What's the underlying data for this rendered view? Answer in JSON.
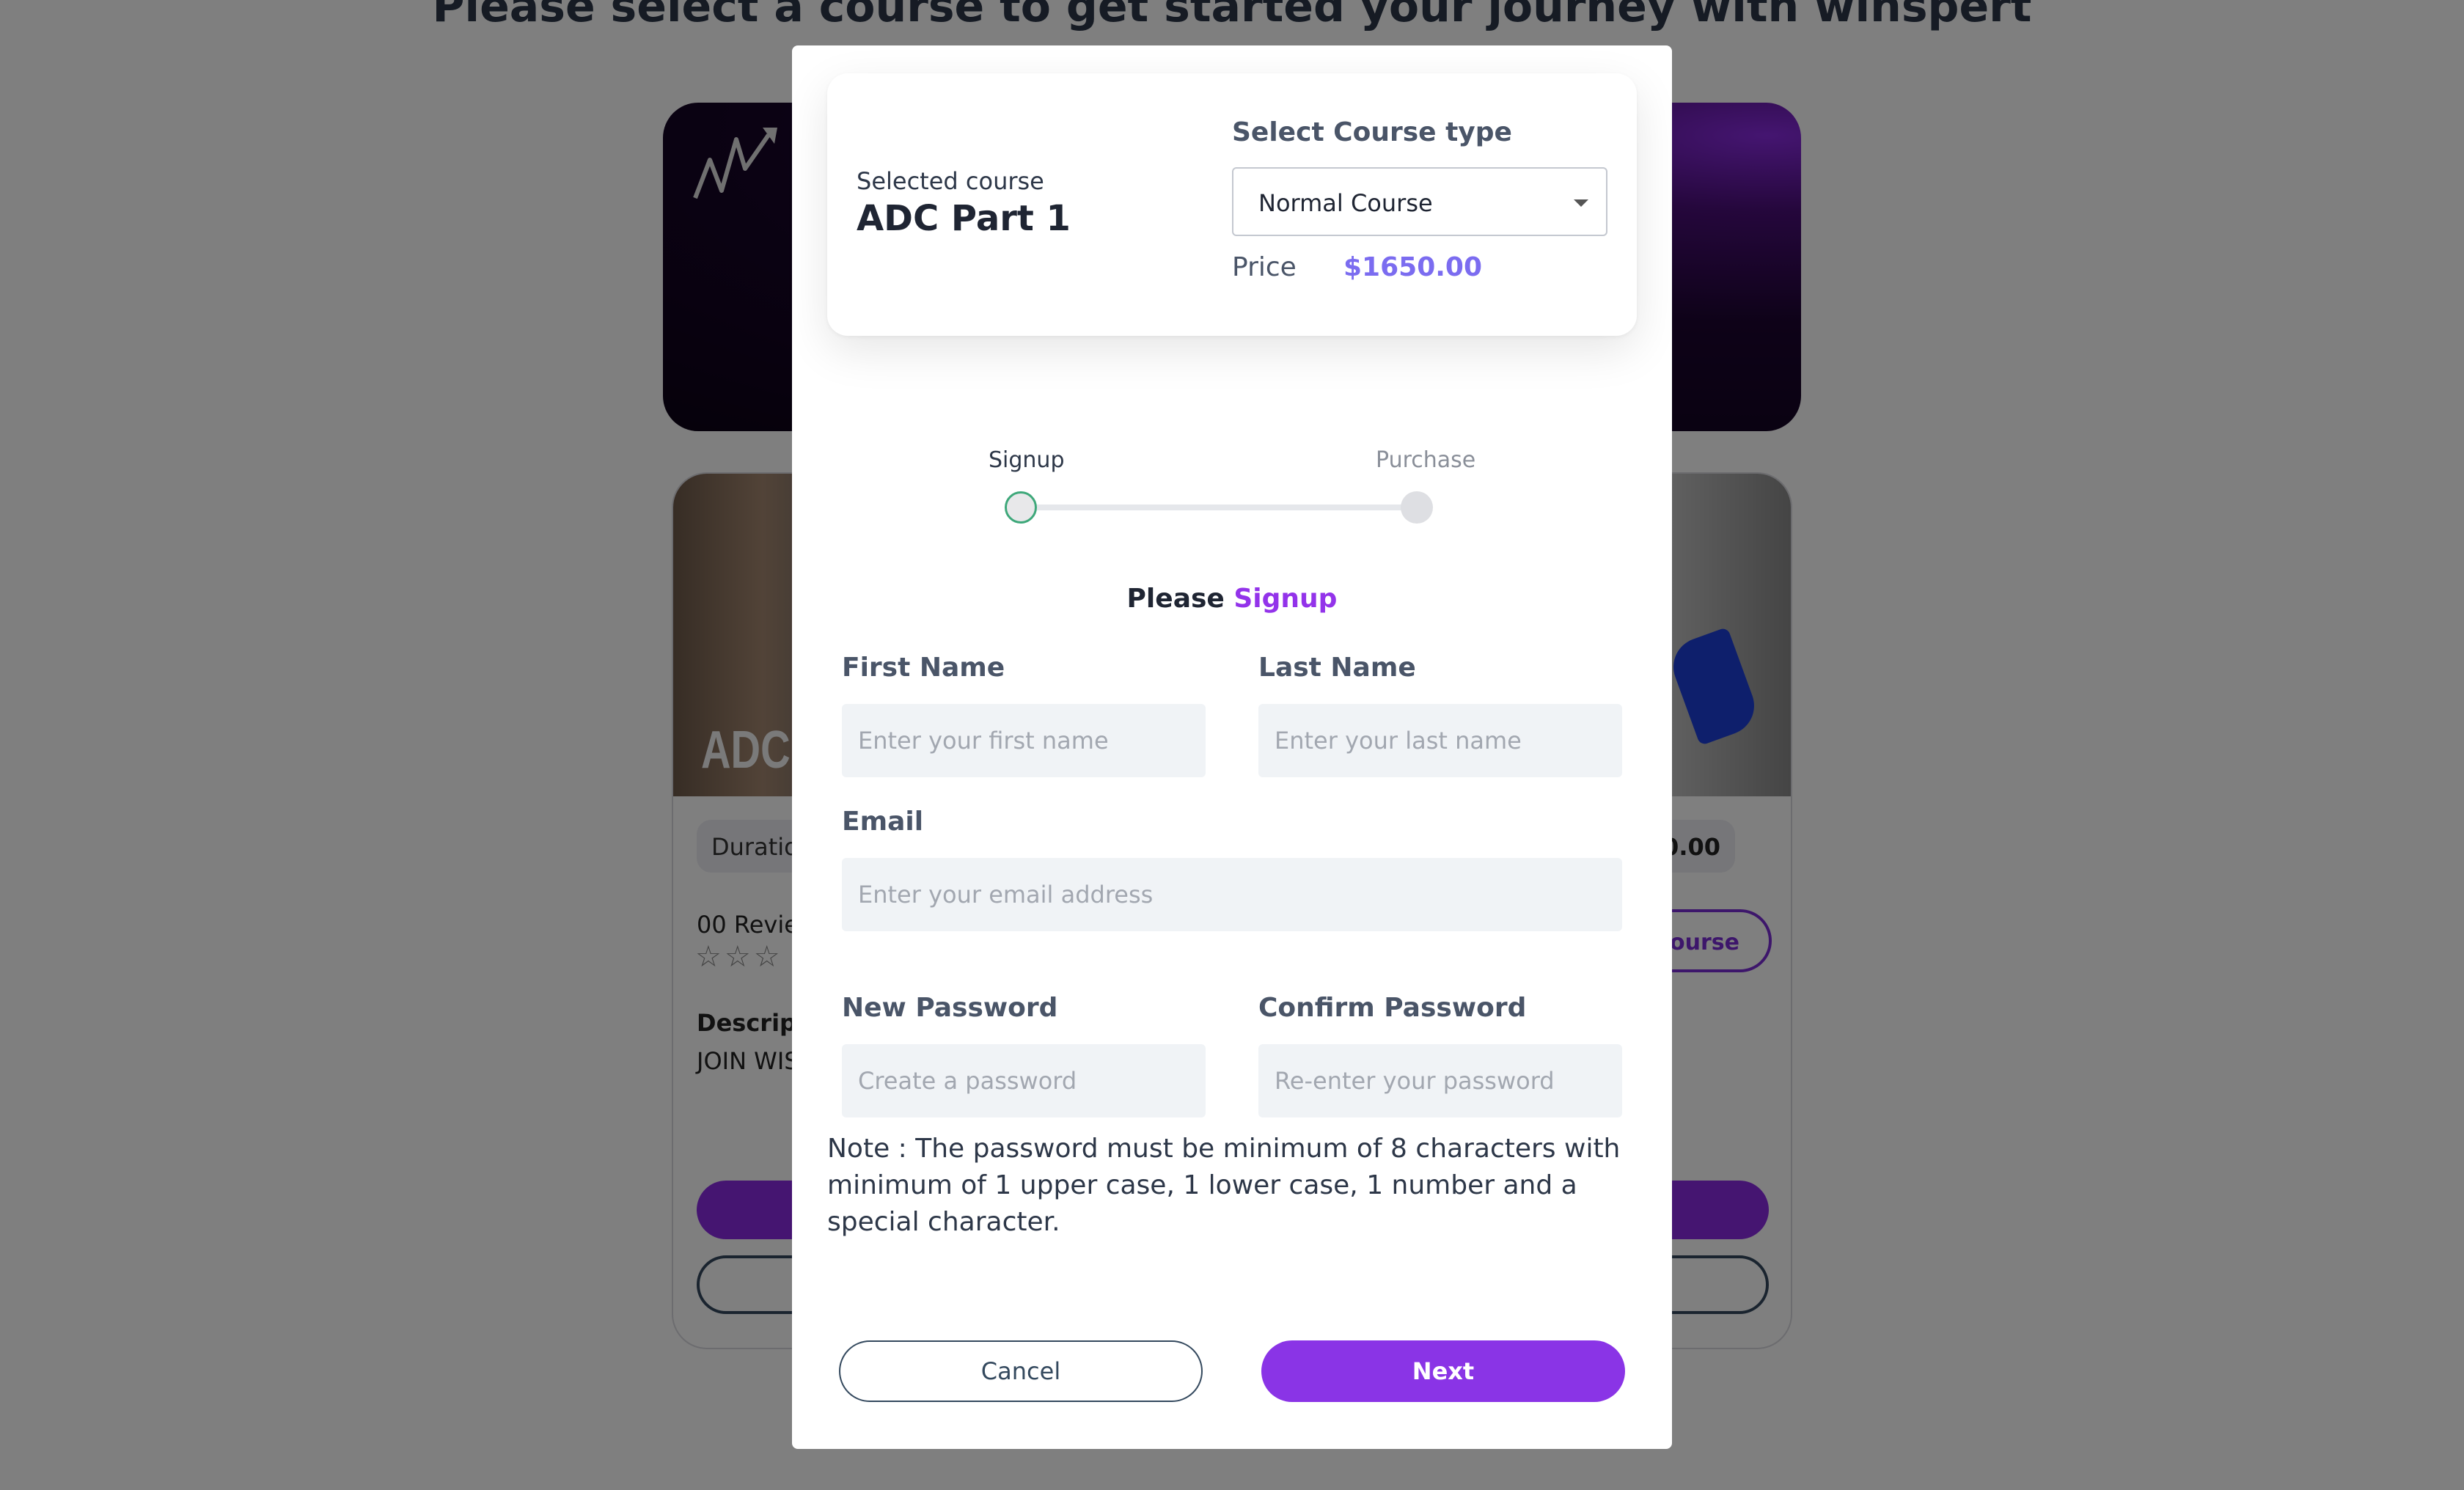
{
  "background": {
    "heading": "Please select a course to get started your journey with winspert",
    "card": {
      "image_title": "ADC P",
      "duration_partial": "Duratio",
      "price_partial": "0.00",
      "reviews_partial": "00 Revie",
      "stars": "☆☆☆",
      "description_label_partial": "Descript",
      "description_text_partial": "JOIN WIS",
      "course_button_partial": "Course"
    }
  },
  "modal": {
    "selected_label": "Selected course",
    "selected_course": "ADC Part 1",
    "course_type_label": "Select Course type",
    "course_type_value": "Normal Course",
    "price_label": "Price",
    "price_value": "$1650.00",
    "stepper": {
      "steps": [
        "Signup",
        "Purchase"
      ],
      "active_step": 0
    },
    "heading_prefix": "Please",
    "heading_accent": "Signup",
    "fields": {
      "first_name": {
        "label": "First Name",
        "placeholder": "Enter your first name",
        "value": ""
      },
      "last_name": {
        "label": "Last Name",
        "placeholder": "Enter your last name",
        "value": ""
      },
      "email": {
        "label": "Email",
        "placeholder": "Enter your email address",
        "value": ""
      },
      "new_password": {
        "label": "New Password",
        "placeholder": "Create a password",
        "value": ""
      },
      "confirm_password": {
        "label": "Confirm Password",
        "placeholder": "Re-enter your password",
        "value": ""
      }
    },
    "note": "Note : The password must be minimum of 8 characters with minimum of 1 upper case, 1 lower case, 1 number and a special character.",
    "buttons": {
      "cancel": "Cancel",
      "next": "Next"
    }
  },
  "colors": {
    "accent_purple": "#8a34e6",
    "price_color": "#7b6cf0",
    "overlay": "rgba(0,0,0,0.5)"
  }
}
